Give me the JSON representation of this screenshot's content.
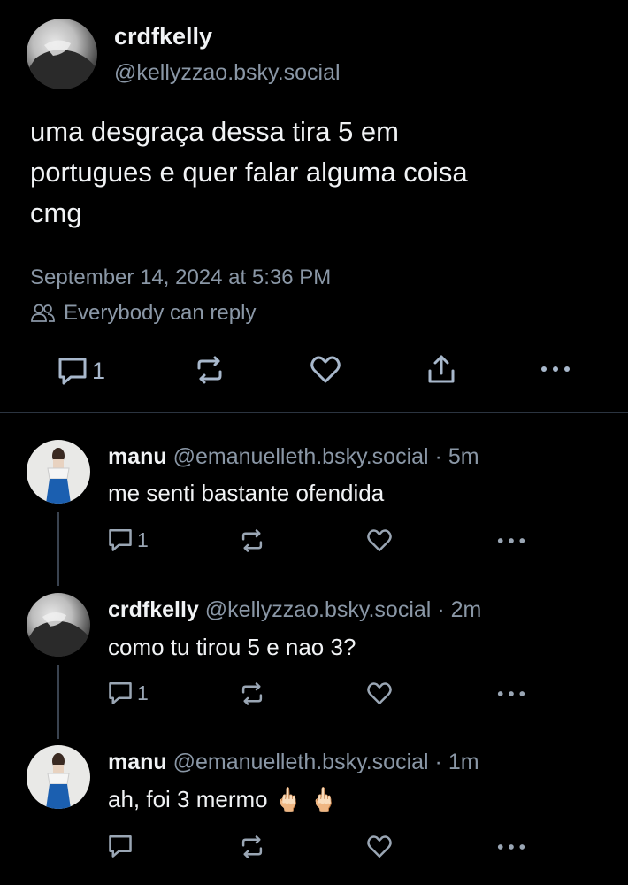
{
  "main_post": {
    "display_name": "crdfkelly",
    "handle": "@kellyzzao.bsky.social",
    "text_line1": "uma desgraça dessa tira 5 em",
    "text_line2": "portugues e quer falar alguma coisa",
    "text_line3": "cmg",
    "timestamp": "September 14, 2024 at 5:36 PM",
    "reply_setting": "Everybody can reply",
    "reply_count": "1",
    "icons": [
      "reply-icon",
      "repost-icon",
      "like-icon",
      "share-icon",
      "more-icon",
      "people-icon"
    ]
  },
  "replies": [
    {
      "display_name": "manu",
      "handle": "@emanuelleth.bsky.social",
      "time": "· 5m",
      "text": "me senti bastante ofendida",
      "reply_count": "1"
    },
    {
      "display_name": "crdfkelly",
      "handle": "@kellyzzao.bsky.social",
      "time": "· 2m",
      "text": "como tu tirou 5 e nao 3?",
      "reply_count": "1"
    },
    {
      "display_name": "manu",
      "handle": "@emanuelleth.bsky.social",
      "time": "· 1m",
      "text": "ah, foi 3 mermo",
      "emoji": "🖕🏻 🖕🏻",
      "reply_count": ""
    }
  ],
  "colors": {
    "background": "#000000",
    "text": "#f1f3f5",
    "muted": "#8a97a6",
    "divider": "#2b3440"
  }
}
